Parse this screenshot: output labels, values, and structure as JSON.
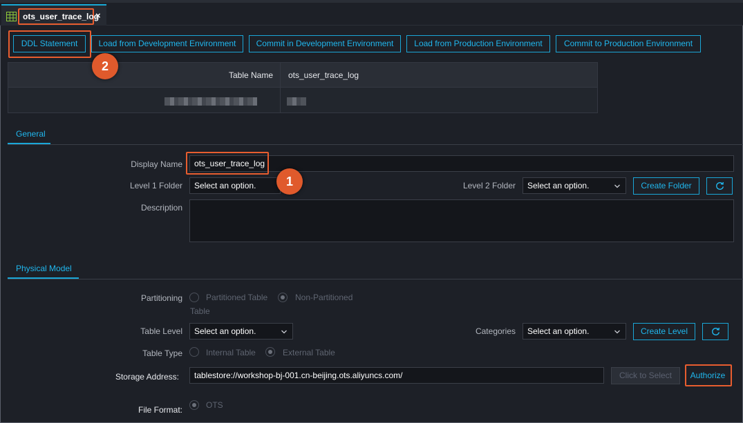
{
  "tab": {
    "title": "ots_user_trace_log",
    "close": "×",
    "icon": "table-grid-icon"
  },
  "toolbar": {
    "ddl": "DDL Statement",
    "load_dev": "Load from Development Environment",
    "commit_dev": "Commit in Development Environment",
    "load_prod": "Load from Production Environment",
    "commit_prod": "Commit to Production Environment"
  },
  "info_table": {
    "label": "Table Name",
    "value": "ots_user_trace_log"
  },
  "badges": {
    "one": "1",
    "two": "2"
  },
  "general": {
    "tab": "General",
    "display_name_label": "Display Name",
    "display_name_value": "ots_user_trace_log",
    "level1_label": "Level 1 Folder",
    "level1_value": "Select an option.",
    "level2_label": "Level 2 Folder",
    "level2_value": "Select an option.",
    "create_folder": "Create Folder",
    "description_label": "Description",
    "description_value": ""
  },
  "physical": {
    "tab": "Physical Model",
    "partitioning_label": "Partitioning",
    "partitioned_option": "Partitioned Table",
    "non_partitioned_option_line1": "Non-Partitioned",
    "non_partitioned_option_line2": "Table",
    "table_level_label": "Table Level",
    "table_level_value": "Select an option.",
    "categories_label": "Categories",
    "categories_value": "Select an option.",
    "create_level": "Create Level",
    "table_type_label": "Table Type",
    "internal_option": "Internal Table",
    "external_option": "External Table",
    "storage_label": "Storage Address:",
    "storage_value": "tablestore://workshop-bj-001.cn-beijing.ots.aliyuncs.com/",
    "click_to_select": "Click to Select",
    "authorize": "Authorize",
    "file_format_label": "File Format:",
    "file_format_option": "OTS"
  },
  "colors": {
    "accent": "#1aa7d8",
    "highlight": "#e85d2f",
    "background": "#1d2027"
  }
}
